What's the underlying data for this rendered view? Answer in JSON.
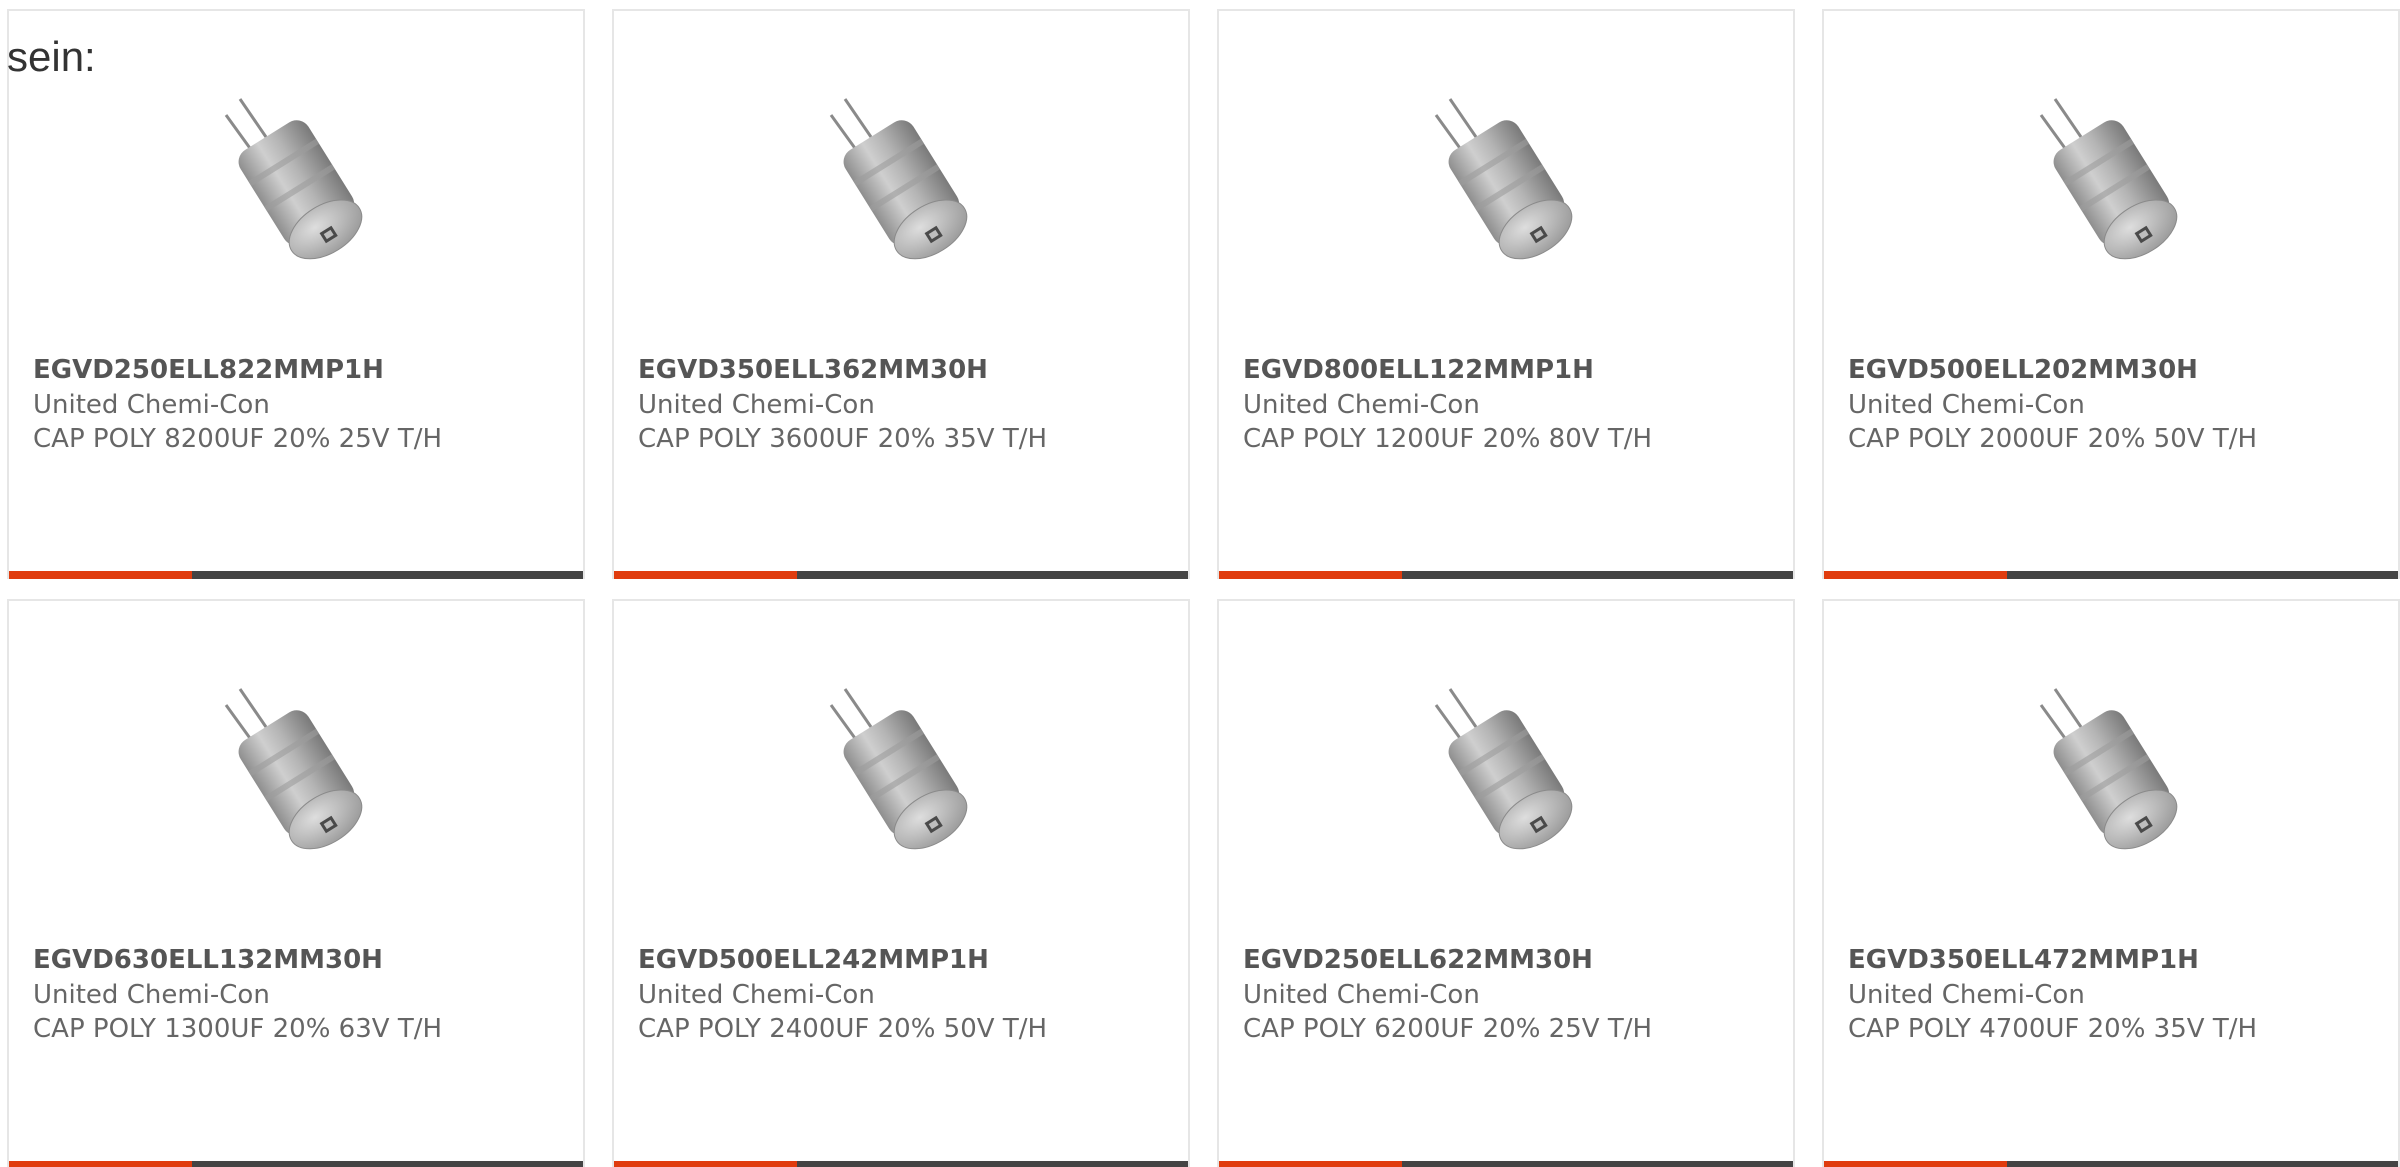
{
  "intro_text": "sein:",
  "colors": {
    "accent": "#e03c0e",
    "bar_dark": "#444444",
    "part_text": "#555555",
    "meta_text": "#666666",
    "card_border": "#e6e6e6"
  },
  "accent_fraction": 0.32,
  "products": [
    {
      "part": "EGVD250ELL822MMP1H",
      "manufacturer": "United Chemi-Con",
      "description": "CAP POLY 8200UF 20% 25V T/H",
      "icon": "capacitor-image"
    },
    {
      "part": "EGVD350ELL362MM30H",
      "manufacturer": "United Chemi-Con",
      "description": "CAP POLY 3600UF 20% 35V T/H",
      "icon": "capacitor-image"
    },
    {
      "part": "EGVD800ELL122MMP1H",
      "manufacturer": "United Chemi-Con",
      "description": "CAP POLY 1200UF 20% 80V T/H",
      "icon": "capacitor-image"
    },
    {
      "part": "EGVD500ELL202MM30H",
      "manufacturer": "United Chemi-Con",
      "description": "CAP POLY 2000UF 20% 50V T/H",
      "icon": "capacitor-image"
    },
    {
      "part": "EGVD630ELL132MM30H",
      "manufacturer": "United Chemi-Con",
      "description": "CAP POLY 1300UF 20% 63V T/H",
      "icon": "capacitor-image"
    },
    {
      "part": "EGVD500ELL242MMP1H",
      "manufacturer": "United Chemi-Con",
      "description": "CAP POLY 2400UF 20% 50V T/H",
      "icon": "capacitor-image"
    },
    {
      "part": "EGVD250ELL622MM30H",
      "manufacturer": "United Chemi-Con",
      "description": "CAP POLY 6200UF 20% 25V T/H",
      "icon": "capacitor-image"
    },
    {
      "part": "EGVD350ELL472MMP1H",
      "manufacturer": "United Chemi-Con",
      "description": "CAP POLY 4700UF 20% 35V T/H",
      "icon": "capacitor-image"
    }
  ]
}
